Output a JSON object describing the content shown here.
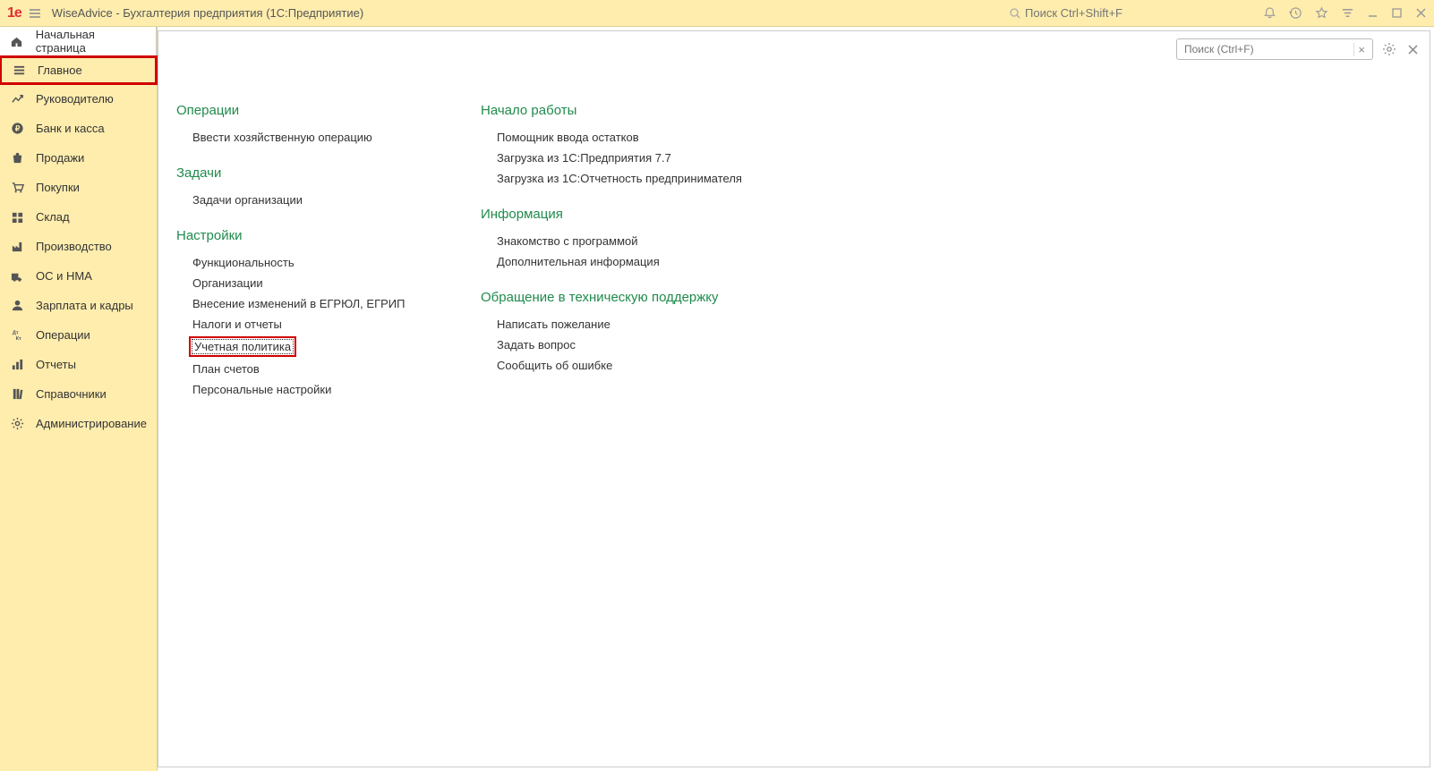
{
  "titlebar": {
    "app_title": "WiseAdvice - Бухгалтерия предприятия  (1С:Предприятие)",
    "search_placeholder": "Поиск Ctrl+Shift+F"
  },
  "sidebar": {
    "items": [
      {
        "label": "Начальная страница",
        "icon": "home",
        "class": "home"
      },
      {
        "label": "Главное",
        "icon": "menu",
        "class": "active"
      },
      {
        "label": "Руководителю",
        "icon": "trend"
      },
      {
        "label": "Банк и касса",
        "icon": "ruble"
      },
      {
        "label": "Продажи",
        "icon": "bag"
      },
      {
        "label": "Покупки",
        "icon": "cart"
      },
      {
        "label": "Склад",
        "icon": "boxes"
      },
      {
        "label": "Производство",
        "icon": "factory"
      },
      {
        "label": "ОС и НМА",
        "icon": "truck"
      },
      {
        "label": "Зарплата и кадры",
        "icon": "person"
      },
      {
        "label": "Операции",
        "icon": "dtkt"
      },
      {
        "label": "Отчеты",
        "icon": "bars"
      },
      {
        "label": "Справочники",
        "icon": "books"
      },
      {
        "label": "Администрирование",
        "icon": "gear"
      }
    ]
  },
  "main_search": {
    "placeholder": "Поиск (Ctrl+F)"
  },
  "content": {
    "col1": [
      {
        "head": "Операции",
        "items": [
          {
            "label": "Ввести хозяйственную операцию"
          }
        ]
      },
      {
        "head": "Задачи",
        "items": [
          {
            "label": "Задачи организации"
          }
        ]
      },
      {
        "head": "Настройки",
        "items": [
          {
            "label": "Функциональность"
          },
          {
            "label": "Организации"
          },
          {
            "label": "Внесение изменений в ЕГРЮЛ, ЕГРИП"
          },
          {
            "label": "Налоги и отчеты"
          },
          {
            "label": "Учетная политика",
            "highlighted": true
          },
          {
            "label": "План счетов"
          },
          {
            "label": "Персональные настройки"
          }
        ]
      }
    ],
    "col2": [
      {
        "head": "Начало работы",
        "items": [
          {
            "label": "Помощник ввода остатков"
          },
          {
            "label": "Загрузка из 1С:Предприятия 7.7"
          },
          {
            "label": "Загрузка из 1С:Отчетность предпринимателя"
          }
        ]
      },
      {
        "head": "Информация",
        "items": [
          {
            "label": "Знакомство с программой"
          },
          {
            "label": "Дополнительная информация"
          }
        ]
      },
      {
        "head": "Обращение в техническую поддержку",
        "items": [
          {
            "label": "Написать пожелание"
          },
          {
            "label": "Задать вопрос"
          },
          {
            "label": "Сообщить об ошибке"
          }
        ]
      }
    ]
  }
}
